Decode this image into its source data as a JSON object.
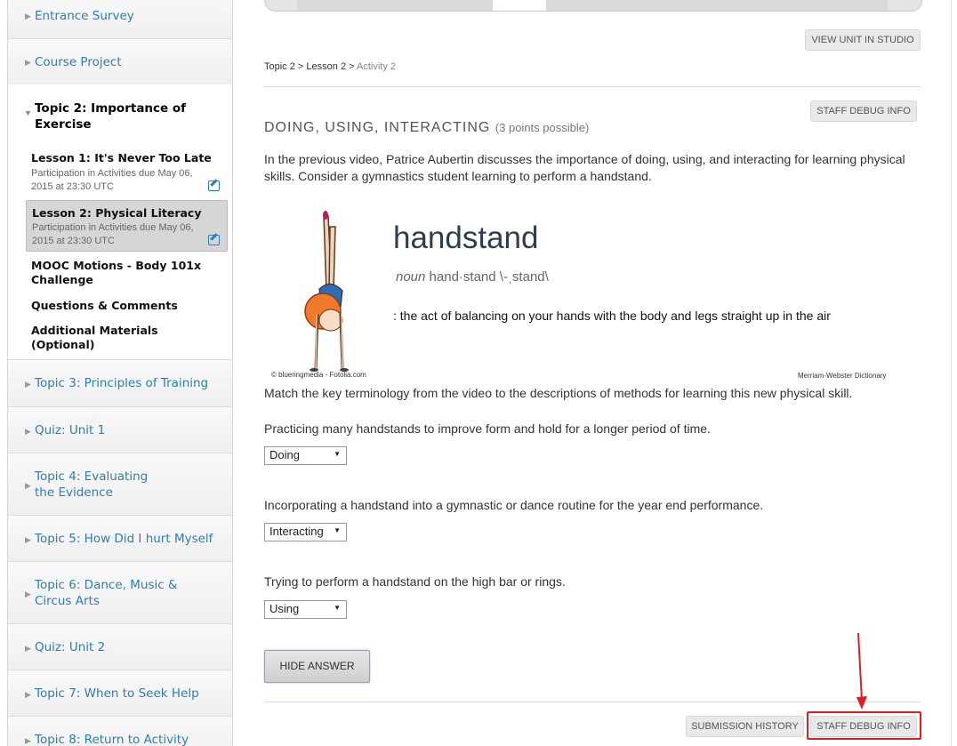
{
  "sidebar": {
    "items_top": [
      {
        "label": "Entrance Survey"
      },
      {
        "label": "Course Project"
      }
    ],
    "open_topic": {
      "title": "Topic 2: Importance of Exercise",
      "lessons": [
        {
          "title": "Lesson 1: It's Never Too Late",
          "due": "Participation in Activities due May 06, 2015 at 23:30 UTC"
        },
        {
          "title": "Lesson 2: Physical Literacy",
          "due": "Participation in Activities due May 06, 2015 at 23:30 UTC"
        }
      ],
      "subs": [
        "MOOC Motions - Body 101x Challenge",
        "Questions & Comments",
        "Additional Materials (Optional)"
      ]
    },
    "items_bottom": [
      {
        "label": "Topic 3: Principles of Training"
      },
      {
        "label": "Quiz: Unit 1"
      },
      {
        "label": "Topic 4: Evaluating the Evidence"
      },
      {
        "label": "Topic 5: How Did I hurt Myself"
      },
      {
        "label": "Topic 6: Dance, Music & Circus Arts"
      },
      {
        "label": "Quiz: Unit 2"
      },
      {
        "label": "Topic 7: When to Seek Help"
      },
      {
        "label": "Topic 8: Return to Activity"
      }
    ]
  },
  "main": {
    "view_unit_label": "VIEW UNIT IN STUDIO",
    "breadcrumb": {
      "a": "Topic 2",
      "sep": ">",
      "b": "Lesson 2",
      "c": "Activity 2"
    },
    "staff_debug_label": "STAFF DEBUG INFO",
    "problem_title": "DOING, USING, INTERACTING",
    "problem_points": "(3 points possible)",
    "intro": "In the previous video, Patrice Aubertin discusses the importance of doing, using, and interacting for learning physical skills. Consider a gymnastics student learning to perform a handstand.",
    "figure": {
      "word": "handstand",
      "pos": "noun",
      "pron": "hand·stand \\-ˌstand\\",
      "definition": ": the act of balancing on your hands with the body and legs straight up in the air",
      "credit_left": "© blueringmedia - Fotolia.com",
      "credit_right": "Merriam-Webster Dictionary"
    },
    "instructions": "Match the key terminology from the video to the descriptions of methods for learning this new physical skill.",
    "questions": [
      {
        "text": "Practicing many handstands to improve form and hold for a longer period of time.",
        "answer": "Doing"
      },
      {
        "text": "Incorporating a handstand into a gymnastic or dance routine for the year end performance.",
        "answer": "Interacting"
      },
      {
        "text": "Trying to perform a handstand on the high bar or rings.",
        "answer": "Using"
      }
    ],
    "hide_answer_label": "HIDE ANSWER",
    "submission_history_label": "SUBMISSION HISTORY",
    "staff_debug_bottom_label": "STAFF DEBUG INFO"
  },
  "colors": {
    "link": "#2a7fb8",
    "highlight": "#e02020"
  }
}
